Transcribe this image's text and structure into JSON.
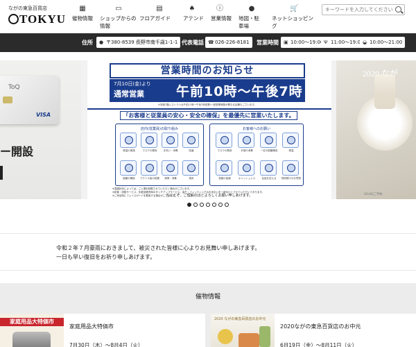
{
  "header": {
    "logo_small": "ながの東急百貨店",
    "logo_main": "TOKYU",
    "nav": [
      {
        "label": "催物情報",
        "icon": "calendar-icon"
      },
      {
        "label": "ショップからの情報",
        "icon": "shopping-bag-icon"
      },
      {
        "label": "フロアガイド",
        "icon": "floor-guide-icon"
      },
      {
        "label": "アテンド",
        "icon": "bell-icon"
      },
      {
        "label": "営業情報",
        "icon": "info-icon"
      },
      {
        "label": "地図・駐車場",
        "icon": "map-pin-icon"
      },
      {
        "label": "ネットショッピング",
        "icon": "cart-icon"
      }
    ],
    "search_placeholder": "キーワードを入力してください"
  },
  "info_bar": {
    "address_label": "住所",
    "address": "〒380-8539 長野市南千歳1-1-1",
    "phone_label": "代表電話",
    "phone": "026-226-8181",
    "hours_label": "営業時間",
    "hours": [
      "10:00～19:00",
      "11:00～19:00",
      "10:00～21:00"
    ]
  },
  "slider": {
    "left_text": "ー開設",
    "left_card_brand": "ToQ",
    "left_card_network": "VISA",
    "right_text": "2020 なが",
    "right_footer": "20:00ご予約",
    "banner": {
      "title": "営業時間のお知らせ",
      "date_line": "7月10日(金)より",
      "mode_line": "通常営業",
      "hours_line": "午前10時～午後7時",
      "hours_note": "※本館7階レストランは午前11時～午後7時営業/一部営業時間が異なる店舗もございます。",
      "message": "「お客様と従業員の安心・安全の確保」を最優先に営業いたします。",
      "staff_group": "店内(従業員)の取り組み",
      "customer_group": "お客様へのお願い",
      "staff_items": [
        "検温の実施",
        "マスクの着用",
        "手洗い・消毒",
        "除菌",
        "距離の確保",
        "アクリル板の設置",
        "清掃・消毒",
        "換気"
      ],
      "customer_items": [
        "マスクの着用",
        "手指の消毒",
        "一定の距離確保",
        "検温",
        "混雑の回避",
        "キャッシュレス",
        "会話を控える",
        "短時間でのお買物"
      ],
      "notes": [
        "※混雑状況によっては、ご入場を制限させていただく場合がございます。",
        "※試食・試飲サービス、化粧品販売時のタッチアップサービス、袋そ・フィッティングのお手伝いを一部中止とさせていただいております。",
        "※ご来店時にフェイスガードを着用する場合がございます。"
      ],
      "closing": "なにとぞ、ご理解のほどよろしくお願い申しあげます。"
    },
    "dots_count": 7,
    "active_dot": 0
  },
  "notice": {
    "line1": "令和２年７月豪雨におきまして、被災された皆様に心よりお見舞い申しあげます。",
    "line2": "一日も早い復旧をお祈り申しあげます。"
  },
  "events": {
    "title": "催物情報",
    "items": [
      {
        "name": "家庭用品大特価市",
        "date": "7月30日（木）～8月4日（火）",
        "thumb_text": "家庭用品大特価市"
      },
      {
        "name": "2020ながの東急百貨店のお中元",
        "date": "6月19日（金）～8月11日（火）",
        "thumb_text": "2020 ながの東急百貨店のお中元"
      }
    ]
  },
  "colors": {
    "navy": "#1a3c8c",
    "dark_bar": "#2b2b2b",
    "sale_red": "#c8252d"
  }
}
